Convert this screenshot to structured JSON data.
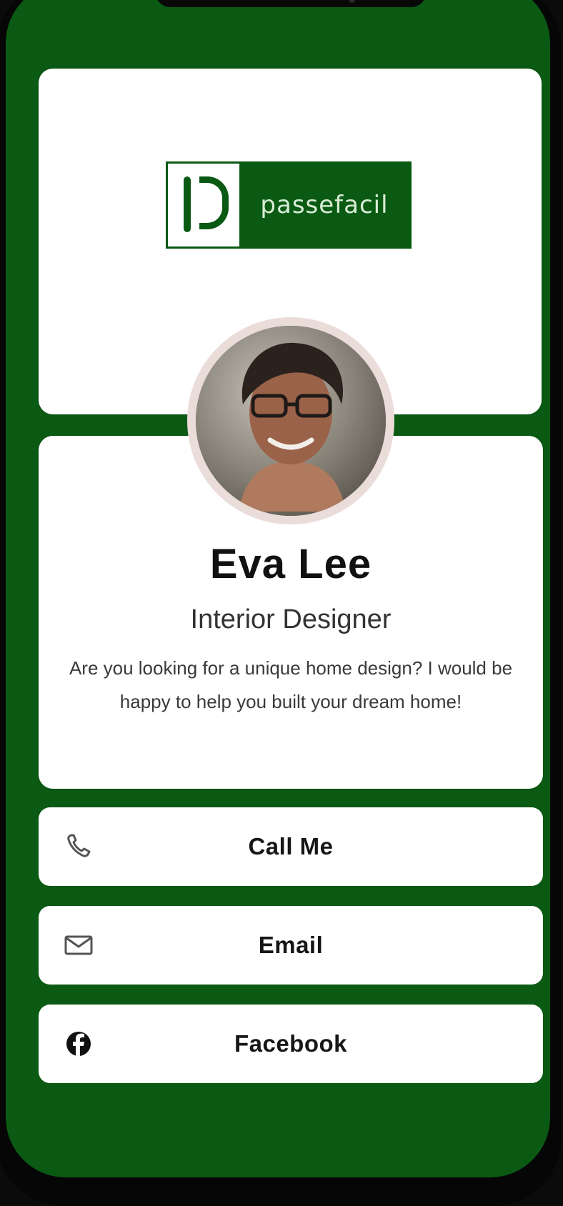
{
  "brand": {
    "name": "passefacil",
    "color": "#0b5a14"
  },
  "profile": {
    "name": "Eva Lee",
    "title": "Interior Designer",
    "bio": "Are you looking for a unique home design? I would be happy to help you built your dream home!"
  },
  "actions": [
    {
      "label": "Call Me",
      "icon": "phone-icon"
    },
    {
      "label": "Email",
      "icon": "mail-icon"
    },
    {
      "label": "Facebook",
      "icon": "facebook-icon"
    }
  ]
}
